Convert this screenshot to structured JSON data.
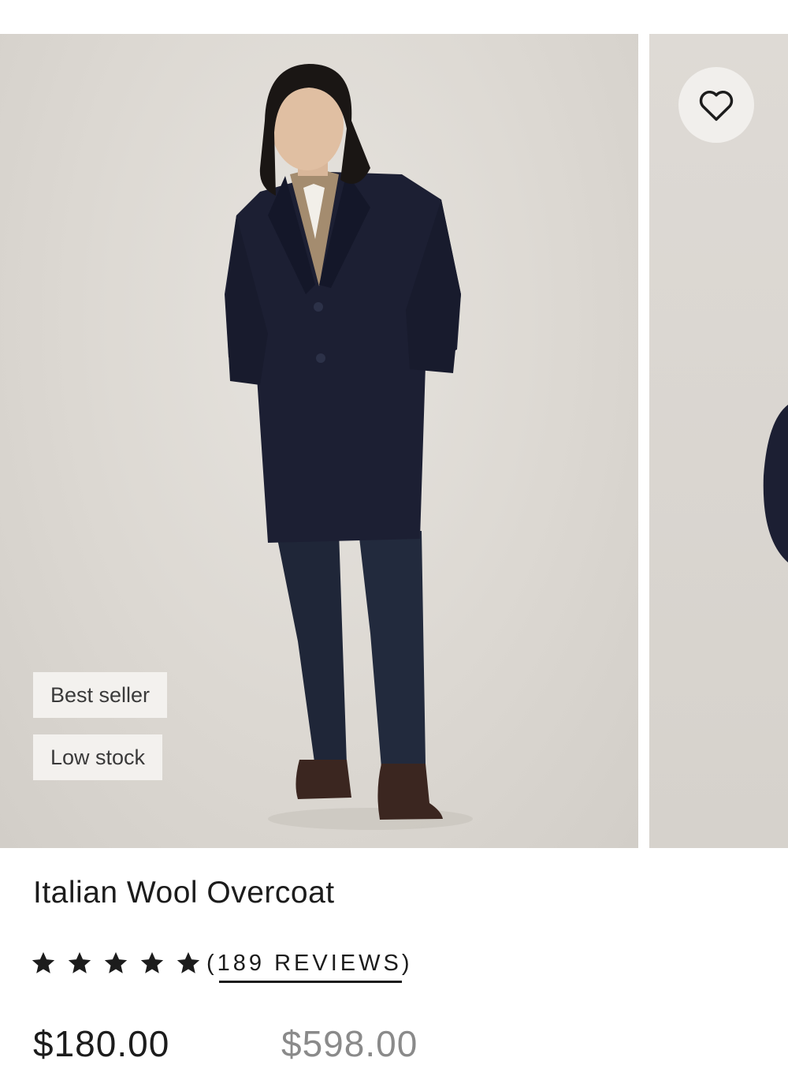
{
  "gallery": {
    "main_image_alt": "Model wearing navy Italian wool overcoat",
    "wishlist_icon": "heart-outline-icon",
    "badges": [
      "Best seller",
      "Low stock"
    ]
  },
  "product": {
    "title": "Italian Wool Overcoat",
    "rating": 5,
    "reviews_label": "(189 REVIEWS)",
    "price": "$180.00",
    "compare_price": "$598.00"
  },
  "colors": {
    "background": "#ffffff",
    "photo_bg": "#dcd8d2",
    "coat": "#1c1f33",
    "text": "#1c1c1c"
  }
}
